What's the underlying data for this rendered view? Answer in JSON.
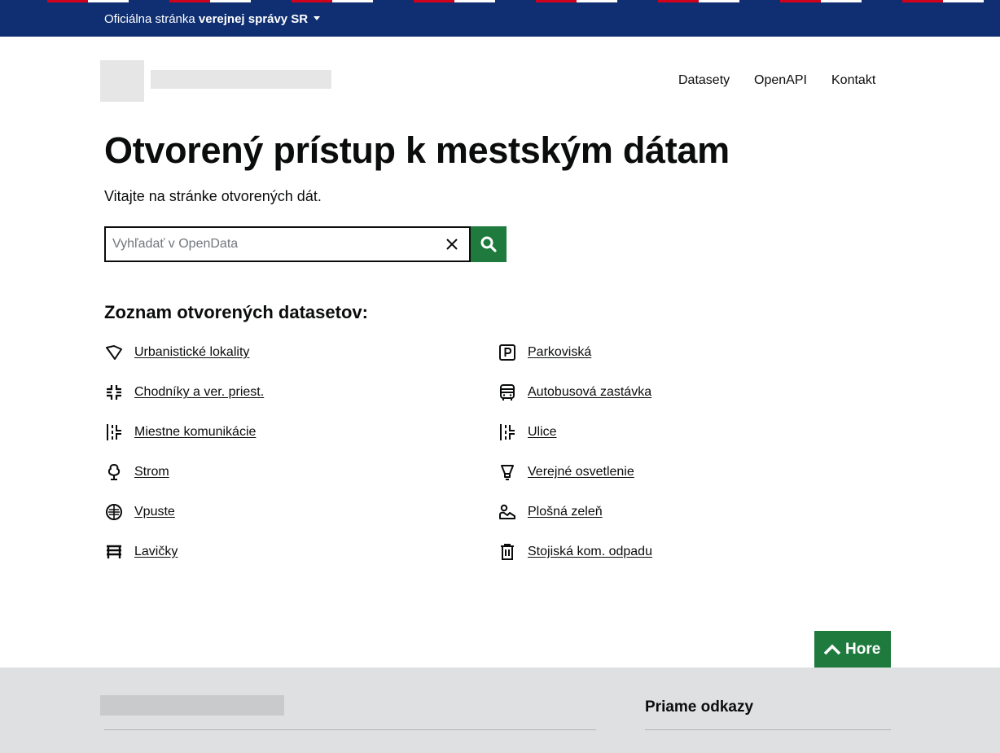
{
  "colors": {
    "gov_bar": "#0f2f72",
    "primary_green": "#1f7a3e",
    "footer_bg": "#dee0e2",
    "stripe_red": "#d0021b",
    "stripe_white": "#ffffff"
  },
  "gov_banner": {
    "prefix": "Oficiálna stránka",
    "emphasis": "verejnej správy SR"
  },
  "header": {
    "nav": [
      {
        "label": "Datasety"
      },
      {
        "label": "OpenAPI"
      },
      {
        "label": "Kontakt"
      }
    ]
  },
  "hero": {
    "title": "Otvorený prístup k mestským dátam",
    "subtitle": "Vitajte na stránke otvorených dát."
  },
  "search": {
    "placeholder": "Vyhľadať v OpenData",
    "value": ""
  },
  "datasets": {
    "title": "Zoznam otvorených datasetov:",
    "items": [
      {
        "label": "Urbanistické lokality",
        "icon": "polygon-icon"
      },
      {
        "label": "Parkoviská",
        "icon": "parking-icon"
      },
      {
        "label": "Chodníky a ver. priest.",
        "icon": "crossroads-icon"
      },
      {
        "label": "Autobusová zastávka",
        "icon": "bus-icon"
      },
      {
        "label": "Miestne komunikácie",
        "icon": "road-icon"
      },
      {
        "label": "Ulice",
        "icon": "road-icon"
      },
      {
        "label": "Strom",
        "icon": "tree-icon"
      },
      {
        "label": "Verejné osvetlenie",
        "icon": "lamp-icon"
      },
      {
        "label": "Vpuste",
        "icon": "drain-icon"
      },
      {
        "label": "Plošná zeleň",
        "icon": "greenery-icon"
      },
      {
        "label": "Lavičky",
        "icon": "bench-icon"
      },
      {
        "label": "Stojiská kom. odpadu",
        "icon": "trash-icon"
      }
    ]
  },
  "back_to_top": {
    "label": "Hore"
  },
  "footer": {
    "links_title": "Priame odkazy"
  }
}
